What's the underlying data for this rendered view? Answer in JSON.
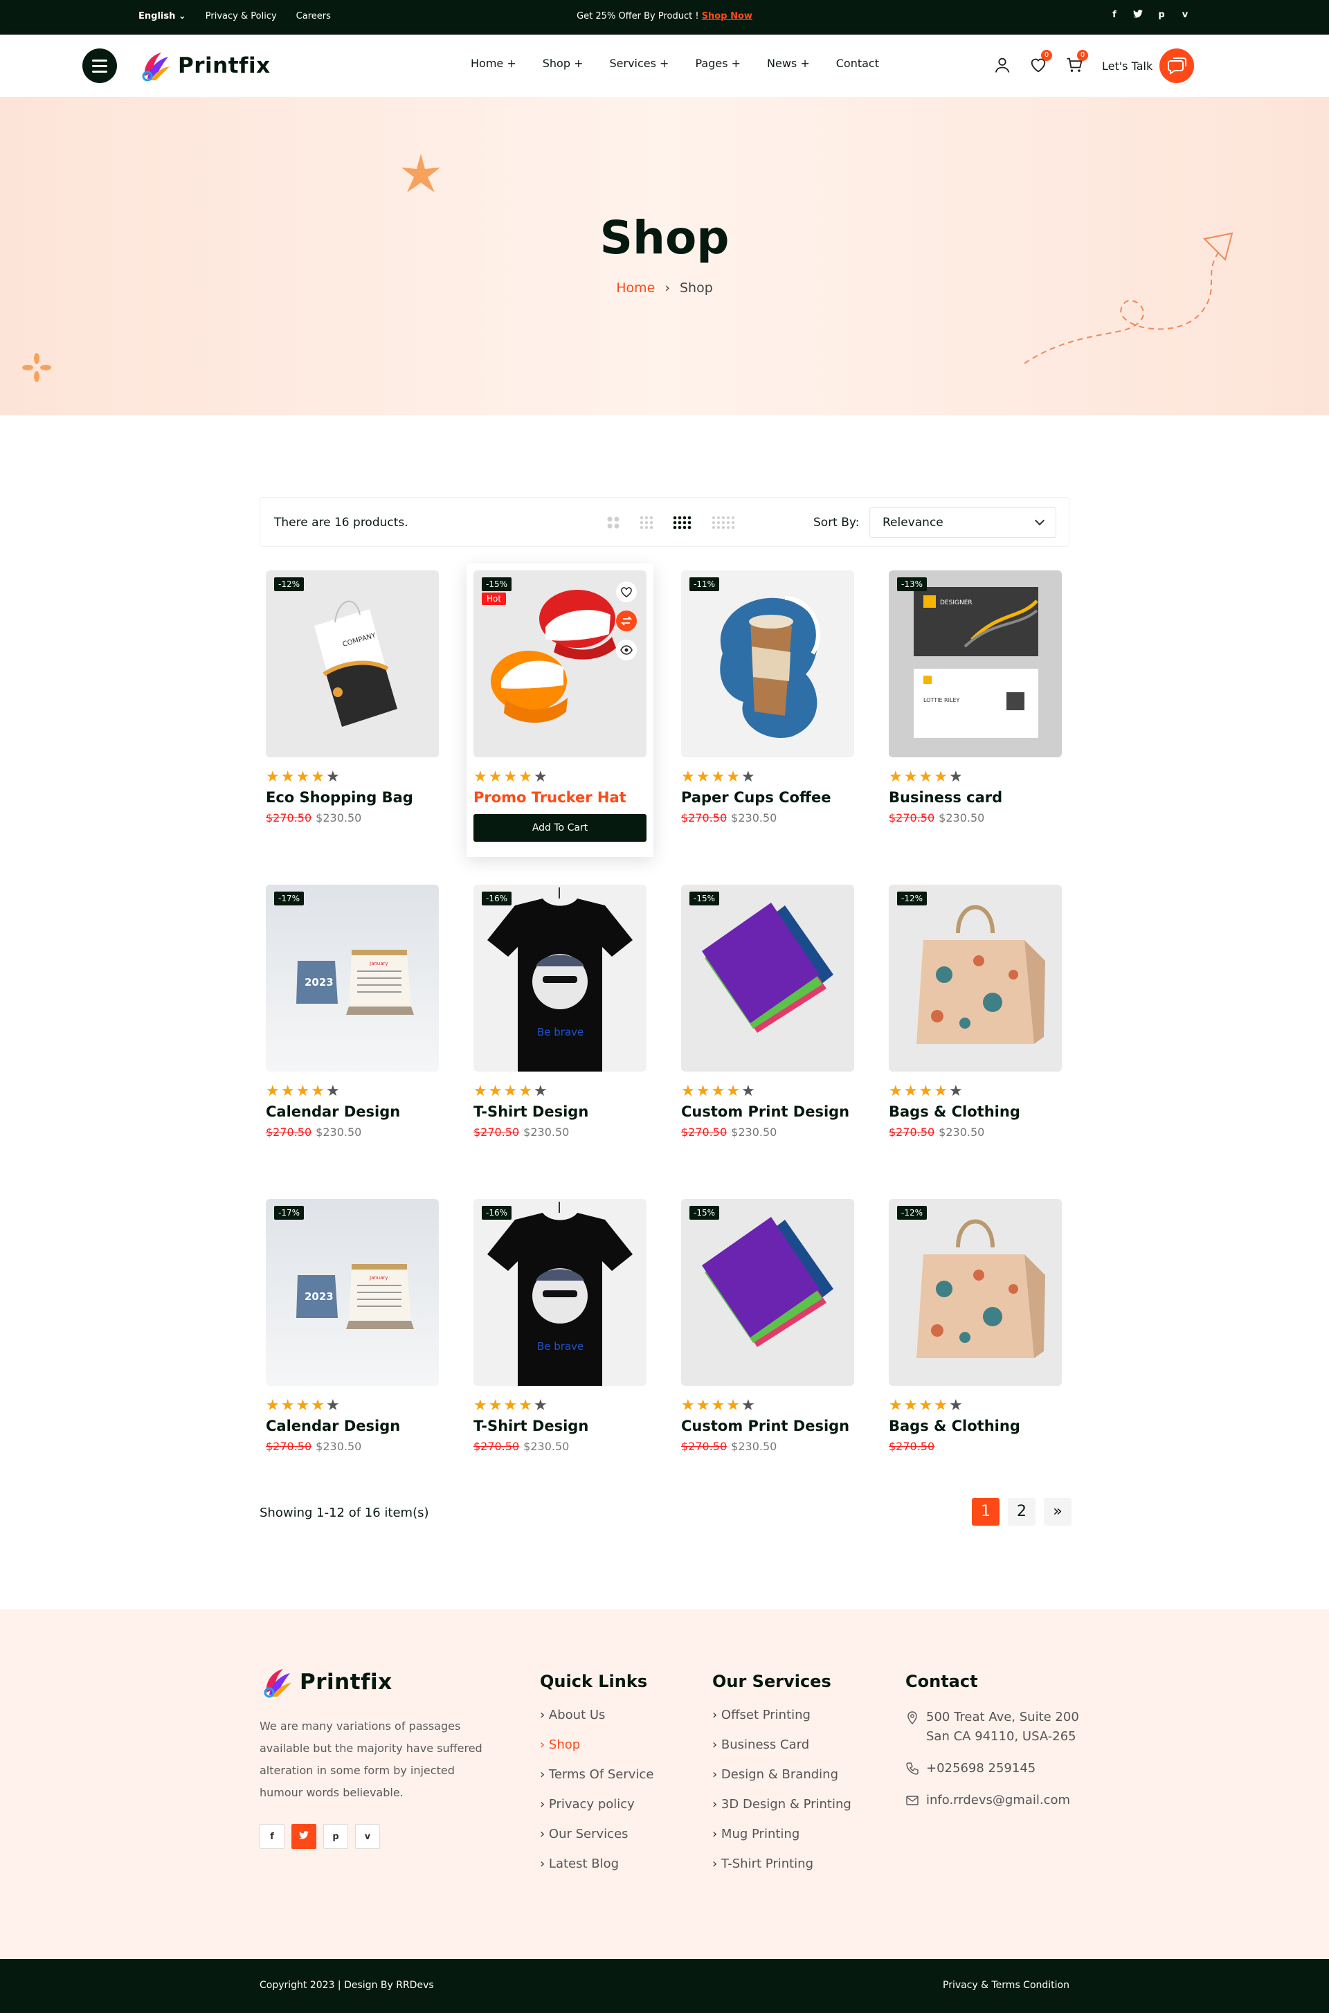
{
  "topbar": {
    "language": "English",
    "links": [
      "Privacy & Policy",
      "Careers"
    ],
    "promo_text": "Get 25% Offer By Product ! ",
    "promo_link": "Shop Now",
    "social": [
      "f",
      "t",
      "p",
      "v"
    ]
  },
  "header": {
    "logo": "Printfix",
    "nav": [
      "Home +",
      "Shop +",
      "Services +",
      "Pages +",
      "News +",
      "Contact"
    ],
    "wishlist_count": "0",
    "cart_count": "0",
    "cta": "Let's Talk"
  },
  "hero": {
    "title": "Shop",
    "breadcrumb_home": "Home",
    "breadcrumb_sep": "›",
    "breadcrumb_current": "Shop"
  },
  "toolbar": {
    "count": "There are 16 products.",
    "sort_label": "Sort By:",
    "sort_value": "Relevance"
  },
  "products": [
    {
      "discount": "-12%",
      "name": "Eco Shopping Bag",
      "old": "$270.50",
      "price": "$230.50",
      "rating": 4
    },
    {
      "discount": "-15%",
      "hot": "Hot",
      "name": "Promo Trucker Hat",
      "old": "",
      "price": "",
      "rating": 4,
      "cta": "Add To Cart"
    },
    {
      "discount": "-11%",
      "name": "Paper Cups Coffee",
      "old": "$270.50",
      "price": "$230.50",
      "rating": 4
    },
    {
      "discount": "-13%",
      "name": "Business card",
      "old": "$270.50",
      "price": "$230.50",
      "rating": 4
    },
    {
      "discount": "-17%",
      "name": "Calendar Design",
      "old": "$270.50",
      "price": "$230.50",
      "rating": 4
    },
    {
      "discount": "-16%",
      "name": "T-Shirt Design",
      "old": "$270.50",
      "price": "$230.50",
      "rating": 4
    },
    {
      "discount": "-15%",
      "name": "Custom Print Design",
      "old": "$270.50",
      "price": "$230.50",
      "rating": 4
    },
    {
      "discount": "-12%",
      "name": "Bags & Clothing",
      "old": "$270.50",
      "price": "$230.50",
      "rating": 4
    },
    {
      "discount": "-17%",
      "name": "Calendar Design",
      "old": "$270.50",
      "price": "$230.50",
      "rating": 4
    },
    {
      "discount": "-16%",
      "name": "T-Shirt Design",
      "old": "$270.50",
      "price": "$230.50",
      "rating": 4
    },
    {
      "discount": "-15%",
      "name": "Custom Print Design",
      "old": "$270.50",
      "price": "$230.50",
      "rating": 4
    },
    {
      "discount": "-12%",
      "name": "Bags & Clothing",
      "old": "$270.50",
      "price": "",
      "rating": 4
    }
  ],
  "pagination": {
    "showing": "Showing 1-12 of 16 item(s)",
    "pages": [
      "1",
      "2",
      "»"
    ]
  },
  "footer": {
    "logo": "Printfix",
    "about": "We are many variations of passages available but the majority have suffered alteration in some form by injected humour words believable.",
    "social": [
      "f",
      "t",
      "p",
      "v"
    ],
    "quick_links_title": "Quick Links",
    "quick_links": [
      "About Us",
      "Shop",
      "Terms Of Service",
      "Privacy policy",
      "Our Services",
      "Latest Blog"
    ],
    "services_title": "Our Services",
    "services": [
      "Offset Printing",
      "Business Card",
      "Design & Branding",
      "3D Design & Printing",
      "Mug Printing",
      "T-Shirt Printing"
    ],
    "contact_title": "Contact",
    "address_1": "500 Treat Ave, Suite 200",
    "address_2": "San  CA 94110, USA-265",
    "phone": "+025698 259145",
    "email": "info.rrdevs@gmail.com",
    "copyright": "Copyright 2023 | Design By RRDevs",
    "legal": "Privacy & Terms Condition"
  },
  "colors": {
    "accent": "#ff4a17",
    "dark": "#06190f",
    "star": "#f7a20e"
  }
}
